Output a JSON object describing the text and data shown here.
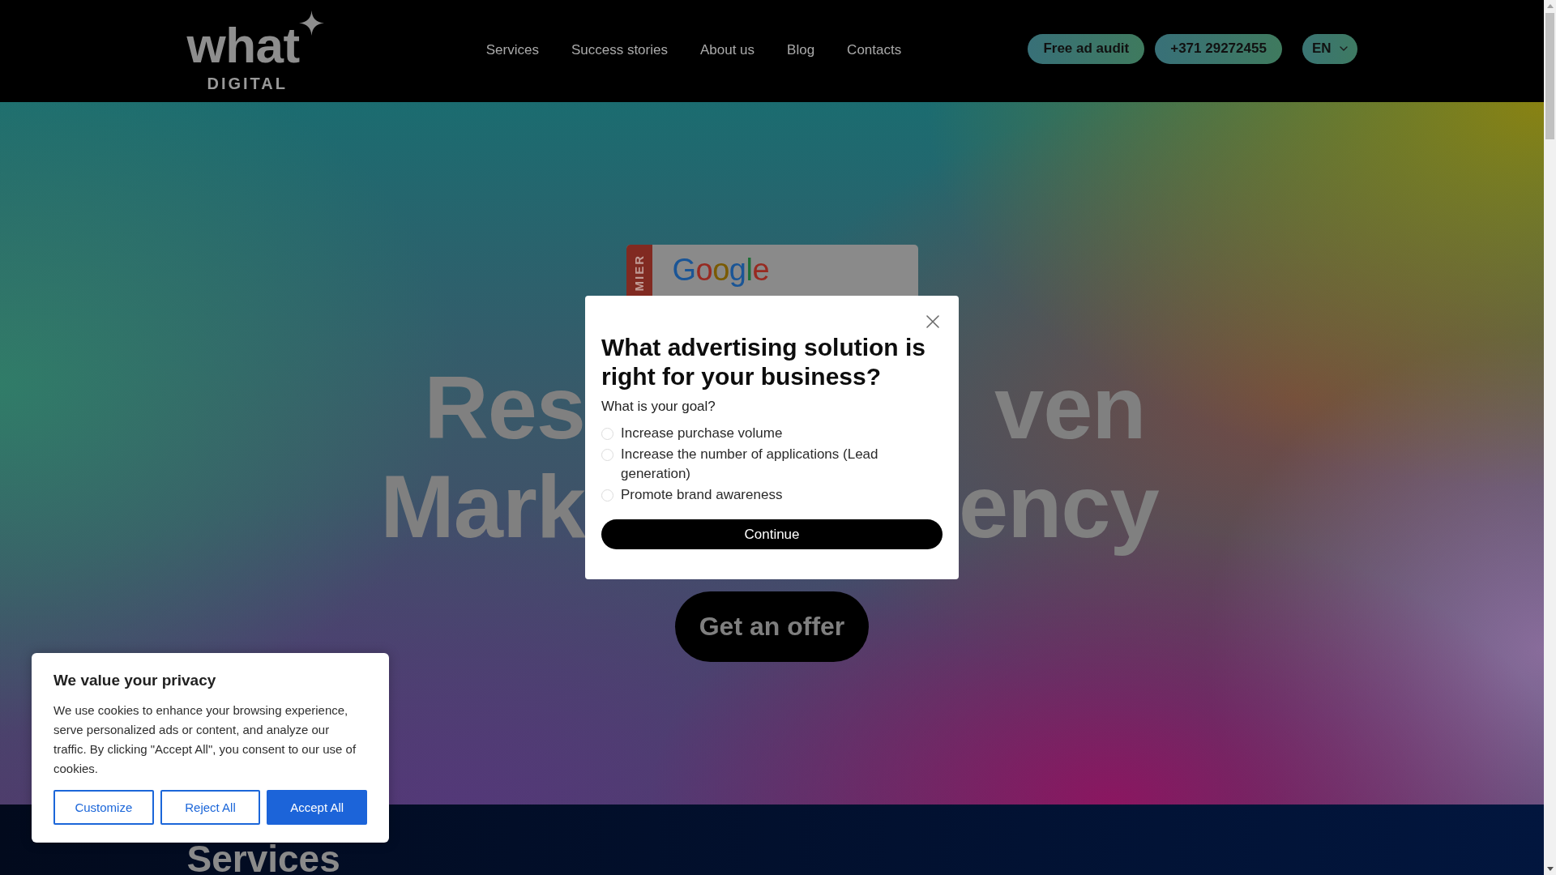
{
  "header": {
    "logo": {
      "wordmark": "what",
      "subtitle": "DIGITAL"
    },
    "nav": [
      "Services",
      "Success stories",
      "About us",
      "Blog",
      "Contacts"
    ],
    "actions": [
      {
        "kind": "button",
        "label": "Free ad audit"
      },
      {
        "kind": "button",
        "label": "+371 29272455"
      },
      {
        "kind": "dropdown",
        "label": "EN"
      }
    ]
  },
  "hero": {
    "badge": {
      "ribbon_text": "MIER",
      "logo_text": "Google"
    },
    "heading_lines": [
      {
        "left": "Res",
        "right": "ven"
      },
      {
        "left": "Mark",
        "right": "ency"
      }
    ],
    "cta": "Get an offer"
  },
  "quiz_modal": {
    "title": "What advertising solution is right for your business?",
    "question": "What is your goal?",
    "options": [
      {
        "label": "Increase purchase volume",
        "selected": false
      },
      {
        "label": "Increase the number of applications (Lead generation)",
        "selected": false
      },
      {
        "label": "Promote brand awareness",
        "selected": false
      }
    ],
    "submit": "Continue"
  },
  "cookie_banner": {
    "title": "We value your privacy",
    "text": "We use cookies to enhance your browsing experience, serve personalized ads or content, and analyze our traffic. By clicking \"Accept All\", you consent to our use of cookies.",
    "buttons": [
      {
        "kind": "outline",
        "label": "Customize"
      },
      {
        "kind": "outline",
        "label": "Reject All"
      },
      {
        "kind": "filled",
        "label": "Accept All"
      }
    ]
  },
  "services_section": {
    "title": "Services"
  }
}
